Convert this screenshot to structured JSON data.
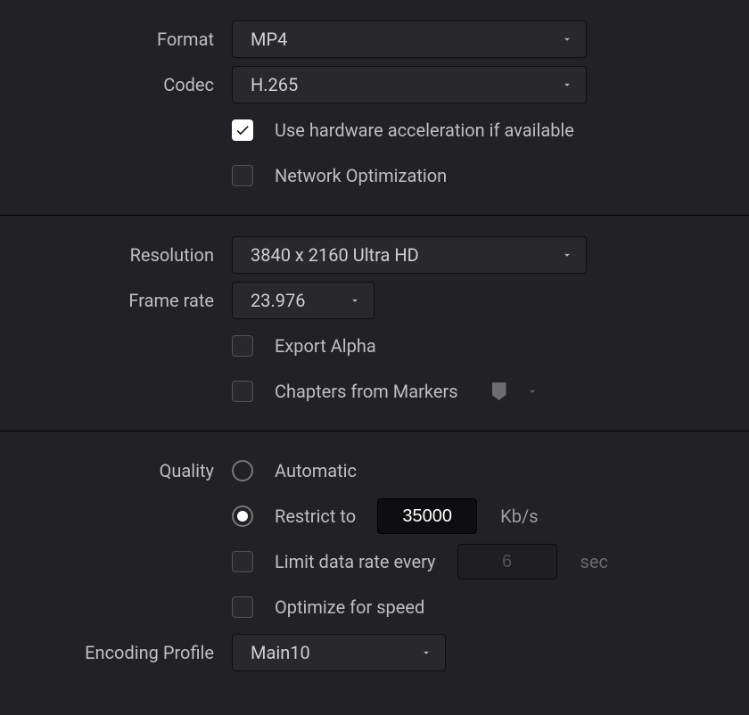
{
  "format": {
    "label": "Format",
    "value": "MP4"
  },
  "codec": {
    "label": "Codec",
    "value": "H.265"
  },
  "hw_accel": {
    "label": "Use hardware acceleration if available",
    "checked": true
  },
  "net_opt": {
    "label": "Network Optimization",
    "checked": false
  },
  "resolution": {
    "label": "Resolution",
    "value": "3840 x 2160 Ultra HD"
  },
  "frame_rate": {
    "label": "Frame rate",
    "value": "23.976"
  },
  "export_alpha": {
    "label": "Export Alpha",
    "checked": false
  },
  "chapters": {
    "label": "Chapters from Markers",
    "checked": false
  },
  "quality": {
    "label": "Quality",
    "automatic_label": "Automatic",
    "restrict_label": "Restrict to",
    "restrict_value": "35000",
    "restrict_unit": "Kb/s",
    "selected": "restrict"
  },
  "limit_rate": {
    "label": "Limit data rate every",
    "value": "6",
    "unit": "sec",
    "checked": false
  },
  "optimize_speed": {
    "label": "Optimize for speed",
    "checked": false
  },
  "encoding_profile": {
    "label": "Encoding Profile",
    "value": "Main10"
  }
}
